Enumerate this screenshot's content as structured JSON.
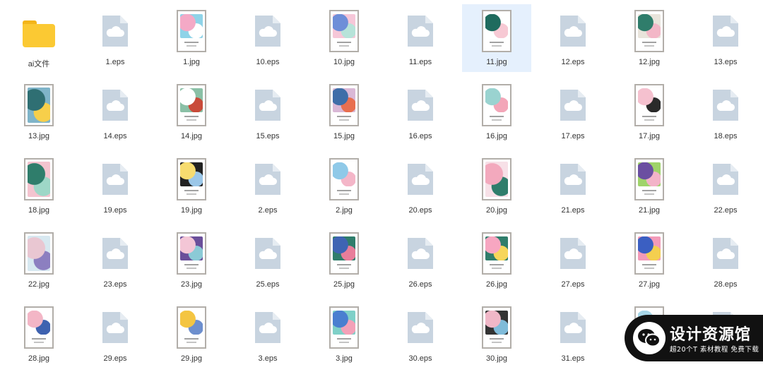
{
  "files": [
    {
      "name": "ai文件",
      "kind": "folder"
    },
    {
      "name": "1.eps",
      "kind": "eps"
    },
    {
      "name": "1.jpg",
      "kind": "jpg",
      "colors": [
        "#f4a9c6",
        "#ffffff",
        "#8fd3e8"
      ]
    },
    {
      "name": "10.eps",
      "kind": "eps"
    },
    {
      "name": "10.jpg",
      "kind": "jpg",
      "colors": [
        "#6e8ed8",
        "#b7e3d9",
        "#f6c7d8"
      ]
    },
    {
      "name": "11.eps",
      "kind": "eps"
    },
    {
      "name": "11.jpg",
      "kind": "jpg",
      "colors": [
        "#1f6b5e",
        "#f7c9d4",
        "#ffffff"
      ],
      "selected": true
    },
    {
      "name": "12.eps",
      "kind": "eps"
    },
    {
      "name": "12.jpg",
      "kind": "jpg",
      "colors": [
        "#2f7d6b",
        "#f3b7c7",
        "#e9e4db"
      ]
    },
    {
      "name": "13.eps",
      "kind": "eps"
    },
    {
      "name": "13.jpg",
      "kind": "jpg",
      "colors": [
        "#2f6f73",
        "#f7cf4a",
        "#7fb4c9"
      ],
      "full": true
    },
    {
      "name": "14.eps",
      "kind": "eps"
    },
    {
      "name": "14.jpg",
      "kind": "jpg",
      "colors": [
        "#ffffff",
        "#c94b3a",
        "#8ac0a6"
      ]
    },
    {
      "name": "15.eps",
      "kind": "eps"
    },
    {
      "name": "15.jpg",
      "kind": "jpg",
      "colors": [
        "#3e6ea8",
        "#e86f4f",
        "#d9b8d6"
      ]
    },
    {
      "name": "16.eps",
      "kind": "eps"
    },
    {
      "name": "16.jpg",
      "kind": "jpg",
      "colors": [
        "#9ad3d0",
        "#f3a6b8",
        "#ffffff"
      ]
    },
    {
      "name": "17.eps",
      "kind": "eps"
    },
    {
      "name": "17.jpg",
      "kind": "jpg",
      "colors": [
        "#f5c1cf",
        "#2a2a2a",
        "#ffffff"
      ]
    },
    {
      "name": "18.eps",
      "kind": "eps"
    },
    {
      "name": "18.jpg",
      "kind": "jpg",
      "colors": [
        "#2f7d6b",
        "#9ed7c7",
        "#f4c4cf"
      ],
      "full": true
    },
    {
      "name": "19.eps",
      "kind": "eps"
    },
    {
      "name": "19.jpg",
      "kind": "jpg",
      "colors": [
        "#f7dc6f",
        "#9bc7e8",
        "#222222"
      ]
    },
    {
      "name": "2.eps",
      "kind": "eps"
    },
    {
      "name": "2.jpg",
      "kind": "jpg",
      "colors": [
        "#8fc9e8",
        "#f4b6c8",
        "#ffffff"
      ]
    },
    {
      "name": "20.eps",
      "kind": "eps"
    },
    {
      "name": "20.jpg",
      "kind": "jpg",
      "colors": [
        "#f3a9bd",
        "#2f7d6b",
        "#f7e0e7"
      ],
      "full": true
    },
    {
      "name": "21.eps",
      "kind": "eps"
    },
    {
      "name": "21.jpg",
      "kind": "jpg",
      "colors": [
        "#6b4fa1",
        "#f3b3c8",
        "#9fd36a"
      ]
    },
    {
      "name": "22.eps",
      "kind": "eps"
    },
    {
      "name": "22.jpg",
      "kind": "jpg",
      "colors": [
        "#e9c7d2",
        "#8c7fc0",
        "#d7e8f0"
      ],
      "full": true
    },
    {
      "name": "23.eps",
      "kind": "eps"
    },
    {
      "name": "23.jpg",
      "kind": "jpg",
      "colors": [
        "#f3c6d6",
        "#8bcad6",
        "#6a4f9a"
      ]
    },
    {
      "name": "25.eps",
      "kind": "eps"
    },
    {
      "name": "25.jpg",
      "kind": "jpg",
      "colors": [
        "#3f64b3",
        "#e87d9a",
        "#2f7d6b"
      ]
    },
    {
      "name": "26.eps",
      "kind": "eps"
    },
    {
      "name": "26.jpg",
      "kind": "jpg",
      "colors": [
        "#f7a6c1",
        "#f6d65a",
        "#2f7d6b"
      ]
    },
    {
      "name": "27.eps",
      "kind": "eps"
    },
    {
      "name": "27.jpg",
      "kind": "jpg",
      "colors": [
        "#3b5fc2",
        "#f4cf4f",
        "#f39ab8"
      ]
    },
    {
      "name": "28.eps",
      "kind": "eps"
    },
    {
      "name": "28.jpg",
      "kind": "jpg",
      "colors": [
        "#f3b6c6",
        "#3e62b0",
        "#ffffff"
      ]
    },
    {
      "name": "29.eps",
      "kind": "eps"
    },
    {
      "name": "29.jpg",
      "kind": "jpg",
      "colors": [
        "#f4c542",
        "#6d8fce",
        "#ffffff"
      ]
    },
    {
      "name": "3.eps",
      "kind": "eps"
    },
    {
      "name": "3.jpg",
      "kind": "jpg",
      "colors": [
        "#4a7fd0",
        "#f3a1b8",
        "#7fd0c8"
      ]
    },
    {
      "name": "30.eps",
      "kind": "eps"
    },
    {
      "name": "30.jpg",
      "kind": "jpg",
      "colors": [
        "#f0b7c7",
        "#7fbbd9",
        "#333333"
      ]
    },
    {
      "name": "31.eps",
      "kind": "eps"
    },
    {
      "name": "",
      "kind": "jpg",
      "colors": [
        "#a8d7e8",
        "#f7c0cf",
        "#ffffff"
      ]
    },
    {
      "name": "",
      "kind": "eps"
    }
  ],
  "watermark": {
    "brand": "设计资源馆",
    "tagline": "超20个T 素材教程 免费下载"
  }
}
